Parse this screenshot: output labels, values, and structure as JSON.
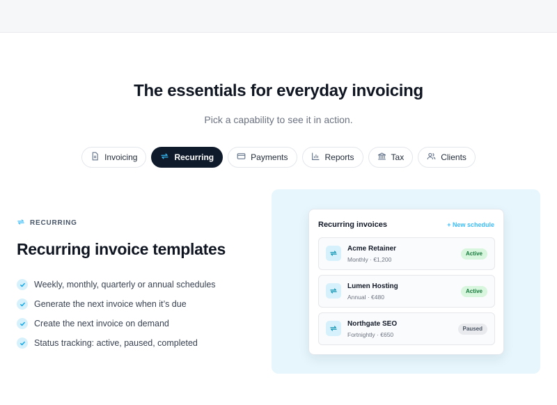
{
  "section": {
    "title": "The essentials for everyday invoicing",
    "subtitle": "Pick a capability to see it in action."
  },
  "tabs": [
    {
      "label": "Invoicing",
      "icon": "document-icon",
      "active": false
    },
    {
      "label": "Recurring",
      "icon": "repeat-icon",
      "active": true
    },
    {
      "label": "Payments",
      "icon": "credit-card-icon",
      "active": false
    },
    {
      "label": "Reports",
      "icon": "bar-chart-icon",
      "active": false
    },
    {
      "label": "Tax",
      "icon": "bank-icon",
      "active": false
    },
    {
      "label": "Clients",
      "icon": "users-icon",
      "active": false
    }
  ],
  "feature": {
    "eyebrow": "RECURRING",
    "title": "Recurring invoice templates",
    "bullets": [
      "Weekly, monthly, quarterly or annual schedules",
      "Generate the next invoice when it’s due",
      "Create the next invoice on demand",
      "Status tracking: active, paused, completed"
    ]
  },
  "preview": {
    "title": "Recurring invoices",
    "new_link": "+ New schedule",
    "rows": [
      {
        "name": "Acme Retainer",
        "meta": "Monthly · €1,200",
        "status": "Active"
      },
      {
        "name": "Lumen Hosting",
        "meta": "Annual · €480",
        "status": "Active"
      },
      {
        "name": "Northgate SEO",
        "meta": "Fortnightly · €650",
        "status": "Paused"
      }
    ]
  },
  "colors": {
    "accent": "#38bdf8",
    "dark": "#0f1b2b",
    "panel_bg": "#e6f6fc",
    "active_badge": "#d8f5dd",
    "paused_badge": "#e8eaee"
  }
}
